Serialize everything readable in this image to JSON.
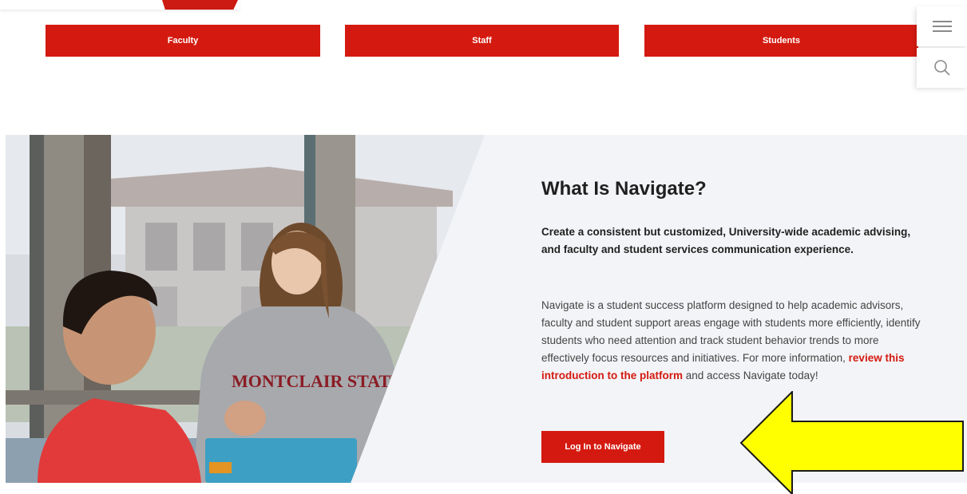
{
  "audience_nav": {
    "faculty_label": "Faculty",
    "staff_label": "Staff",
    "students_label": "Students"
  },
  "utility": {
    "menu_icon": "hamburger-menu-icon",
    "search_icon": "search-icon"
  },
  "feature": {
    "heading": "What Is Navigate?",
    "lead": "Create a consistent but customized, University-wide academic advising, and faculty and student services communication experience.",
    "body_before_link": "Navigate is a student success platform designed to help academic advisors, faculty and student support areas engage with students more efficiently, identify students who need attention and track student behavior trends to more effectively focus resources and initiatives. For more information, ",
    "body_link": "review this introduction to the platform",
    "body_after_link": " and access Navigate today!",
    "login_label": "Log In to Navigate",
    "photo_sweatshirt_text": "MONTCLAIR STATE"
  },
  "colors": {
    "brand_red": "#d41a10",
    "section_bg": "#f3f4f7",
    "arrow_fill": "#ffff00"
  }
}
